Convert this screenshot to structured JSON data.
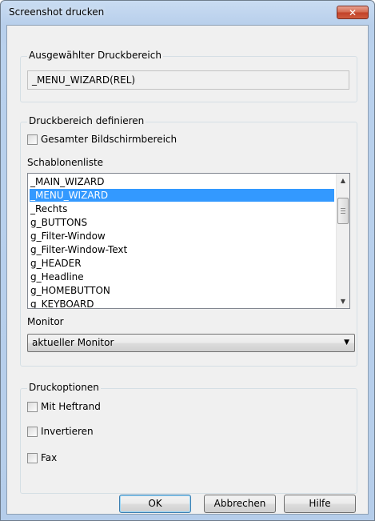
{
  "window": {
    "title": "Screenshot drucken",
    "close_label": "✕"
  },
  "selected_area": {
    "legend": "Ausgewählter Druckbereich",
    "value": "_MENU_WIZARD(REL)"
  },
  "define_area": {
    "legend": "Druckbereich definieren",
    "fullscreen_label": "Gesamter Bildschirmbereich",
    "fullscreen_checked": false,
    "template_list_label": "Schablonenliste",
    "template_items": [
      "_MAIN_WIZARD",
      "_MENU_WIZARD",
      "_Rechts",
      "g_BUTTONS",
      "g_Filter-Window",
      "g_Filter-Window-Text",
      "g_HEADER",
      "g_Headline",
      "g_HOMEBUTTON",
      "g_KEYBOARD"
    ],
    "selected_template": "_MENU_WIZARD",
    "monitor_label": "Monitor",
    "monitor_value": "aktueller Monitor"
  },
  "print_options": {
    "legend": "Druckoptionen",
    "options": [
      {
        "label": "Mit Heftrand",
        "checked": false
      },
      {
        "label": "Invertieren",
        "checked": false
      },
      {
        "label": "Fax",
        "checked": false
      }
    ]
  },
  "buttons": {
    "ok": "OK",
    "cancel": "Abbrechen",
    "help": "Hilfe"
  },
  "icons": {
    "close": "close-icon",
    "scroll_up": "arrow-up-icon",
    "scroll_down": "arrow-down-icon",
    "dropdown": "chevron-down-icon"
  }
}
